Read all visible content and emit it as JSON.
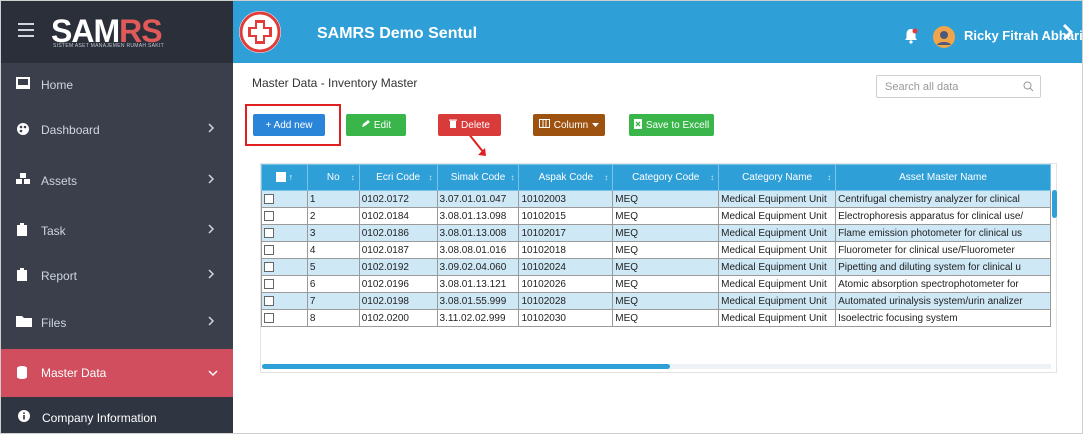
{
  "brand": {
    "name_left": "SAM",
    "name_right": "RS",
    "tagline": "SISTEM ASET MANAJEMEN RUMAH SAKIT"
  },
  "header": {
    "app_title": "SAMRS Demo Sentul",
    "user_name": "Ricky Fitrah Abhari"
  },
  "sidebar": {
    "items": [
      {
        "label": "Home",
        "icon": "monitor-icon"
      },
      {
        "label": "Dashboard",
        "icon": "palette-icon"
      },
      {
        "label": "Assets",
        "icon": "cubes-icon"
      },
      {
        "label": "Task",
        "icon": "task-icon"
      },
      {
        "label": "Report",
        "icon": "report-icon"
      },
      {
        "label": "Files",
        "icon": "folder-icon"
      },
      {
        "label": "Master Data",
        "icon": "database-icon"
      },
      {
        "label": "Company Information",
        "icon": "info-icon"
      }
    ]
  },
  "content": {
    "breadcrumb": "Master Data - Inventory Master",
    "search_placeholder": "Search all data",
    "buttons": {
      "add": "+ Add new",
      "edit": "Edit",
      "delete": "Delete",
      "column": "Column",
      "export": "Save to Excell"
    }
  },
  "table": {
    "columns": [
      "No",
      "Ecri Code",
      "Simak Code",
      "Aspak Code",
      "Category Code",
      "Category Name",
      "Asset Master Name"
    ],
    "rows": [
      [
        "1",
        "0102.0172",
        "3.07.01.01.047",
        "10102003",
        "MEQ",
        "Medical Equipment Unit",
        "Centrifugal chemistry analyzer for clinical"
      ],
      [
        "2",
        "0102.0184",
        "3.08.01.13.098",
        "10102015",
        "MEQ",
        "Medical Equipment Unit",
        "Electrophoresis apparatus for clinical use/"
      ],
      [
        "3",
        "0102.0186",
        "3.08.01.13.008",
        "10102017",
        "MEQ",
        "Medical Equipment Unit",
        "Flame emission photometer for clinical us"
      ],
      [
        "4",
        "0102.0187",
        "3.08.08.01.016",
        "10102018",
        "MEQ",
        "Medical Equipment Unit",
        "Fluorometer for clinical use/Fluorometer"
      ],
      [
        "5",
        "0102.0192",
        "3.09.02.04.060",
        "10102024",
        "MEQ",
        "Medical Equipment Unit",
        "Pipetting and diluting system for clinical u"
      ],
      [
        "6",
        "0102.0196",
        "3.08.01.13.121",
        "10102026",
        "MEQ",
        "Medical Equipment Unit",
        "Atomic absorption spectrophotometer for"
      ],
      [
        "7",
        "0102.0198",
        "3.08.01.55.999",
        "10102028",
        "MEQ",
        "Medical Equipment Unit",
        "Automated urinalysis system/urin analizer"
      ],
      [
        "8",
        "0102.0200",
        "3.11.02.02.999",
        "10102030",
        "MEQ",
        "Medical Equipment Unit",
        "Isoelectric focusing system"
      ]
    ]
  },
  "colors": {
    "primary": "#2f9fd8",
    "sidebar": "#3a3f4b",
    "active": "#d04e5e"
  }
}
